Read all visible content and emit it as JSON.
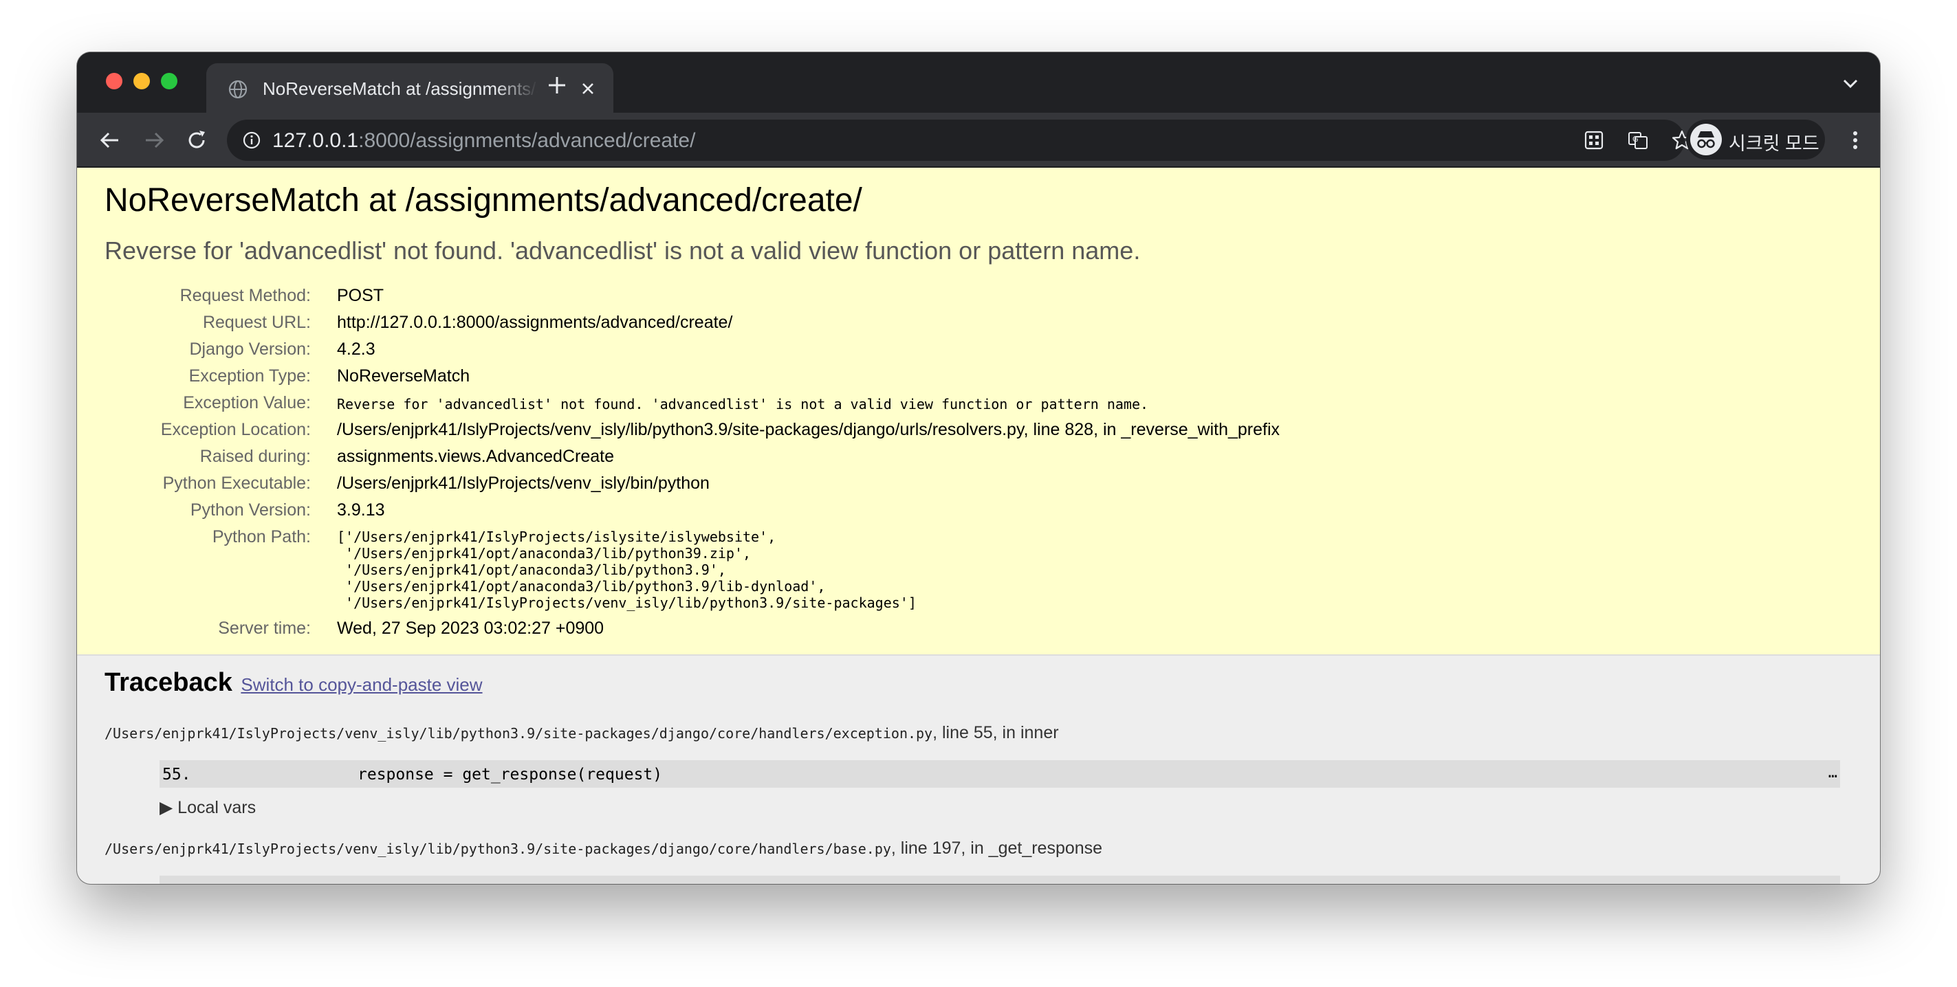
{
  "browser": {
    "tab_title": "NoReverseMatch at /assignments/advanced/create/",
    "url_host": "127.0.0.1",
    "url_rest": ":8000/assignments/advanced/create/",
    "profile_label": "시크릿 모드"
  },
  "error": {
    "title": "NoReverseMatch at /assignments/advanced/create/",
    "message": "Reverse for 'advancedlist' not found. 'advancedlist' is not a valid view function or pattern name.",
    "meta": {
      "request_method_label": "Request Method:",
      "request_method": "POST",
      "request_url_label": "Request URL:",
      "request_url": "http://127.0.0.1:8000/assignments/advanced/create/",
      "django_version_label": "Django Version:",
      "django_version": "4.2.3",
      "exception_type_label": "Exception Type:",
      "exception_type": "NoReverseMatch",
      "exception_value_label": "Exception Value:",
      "exception_value": "Reverse for 'advancedlist' not found. 'advancedlist' is not a valid view function or pattern name.",
      "exception_location_label": "Exception Location:",
      "exception_location": "/Users/enjprk41/IslyProjects/venv_isly/lib/python3.9/site-packages/django/urls/resolvers.py, line 828, in _reverse_with_prefix",
      "raised_during_label": "Raised during:",
      "raised_during": "assignments.views.AdvancedCreate",
      "python_executable_label": "Python Executable:",
      "python_executable": "/Users/enjprk41/IslyProjects/venv_isly/bin/python",
      "python_version_label": "Python Version:",
      "python_version": "3.9.13",
      "python_path_label": "Python Path:",
      "python_path": "['/Users/enjprk41/IslyProjects/islysite/islywebsite',\n '/Users/enjprk41/opt/anaconda3/lib/python39.zip',\n '/Users/enjprk41/opt/anaconda3/lib/python3.9',\n '/Users/enjprk41/opt/anaconda3/lib/python3.9/lib-dynload',\n '/Users/enjprk41/IslyProjects/venv_isly/lib/python3.9/site-packages']",
      "server_time_label": "Server time:",
      "server_time": "Wed, 27 Sep 2023 03:02:27 +0900"
    }
  },
  "traceback": {
    "title": "Traceback",
    "switch_link": "Switch to copy-and-paste view",
    "frames": [
      {
        "path": "/Users/enjprk41/IslyProjects/venv_isly/lib/python3.9/site-packages/django/core/handlers/exception.py",
        "location": ", line 55, in inner",
        "lineno": "55.",
        "code": "response = get_response(request)",
        "ellipsis": "…",
        "local_vars": "▶ Local vars"
      },
      {
        "path": "/Users/enjprk41/IslyProjects/venv_isly/lib/python3.9/site-packages/django/core/handlers/base.py",
        "location": ", line 197, in _get_response"
      }
    ]
  },
  "colors": {
    "summary_bg": "#ffffcc",
    "page_bg": "#eeeeee",
    "link": "#555599",
    "chrome_dark": "#202124",
    "chrome_toolbar": "#35363a"
  },
  "icons": {
    "tab_favicon": "globe-icon",
    "back": "arrow-left-icon",
    "forward": "arrow-right-icon",
    "reload": "reload-icon",
    "site_info": "info-icon",
    "install": "app-install-icon",
    "translate": "translate-icon",
    "bookmark": "star-icon",
    "side_panel": "side-panel-icon",
    "incognito": "incognito-icon",
    "menu": "kebab-menu-icon"
  }
}
